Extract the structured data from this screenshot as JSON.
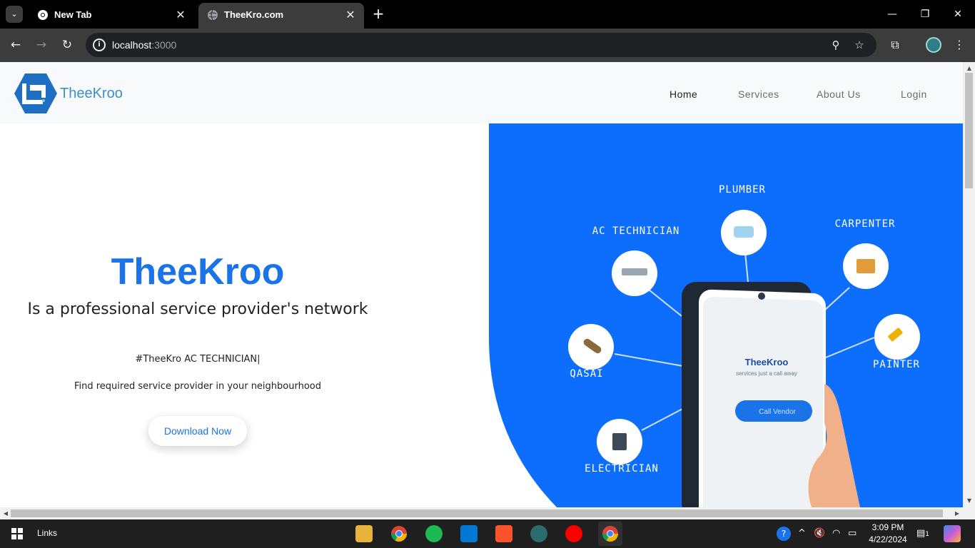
{
  "browser": {
    "tabs": [
      {
        "title": "New Tab"
      },
      {
        "title": "TheeKro.com"
      }
    ],
    "url_host": "localhost",
    "url_port": ":3000",
    "tab_close": "✕",
    "new_tab": "+"
  },
  "site": {
    "logo_text": "TheeKroo",
    "nav": [
      "Home",
      "Services",
      "About Us",
      "Login"
    ],
    "hero": {
      "title": "TheeKroo",
      "subtitle": "Is a professional service provider's network",
      "typed": "#TheeKro AC TECHNICIAN|",
      "tagline": "Find required service provider in your neighbourhood",
      "cta": "Download Now"
    },
    "illustration": {
      "labels": [
        "PLUMBER",
        "AC TECHNICIAN",
        "CARPENTER",
        "QASAI",
        "PAINTER",
        "ELECTRICIAN"
      ],
      "phone_brand": "TheeKroo",
      "phone_tagline": "services just a call away",
      "phone_button": "Call Vendor"
    },
    "colors": {
      "primary": "#1a73e8",
      "hero_bg": "#0d6efd"
    }
  },
  "taskbar": {
    "links_label": "Links",
    "time": "3:09 PM",
    "date": "4/22/2024",
    "notification_count": "1"
  }
}
